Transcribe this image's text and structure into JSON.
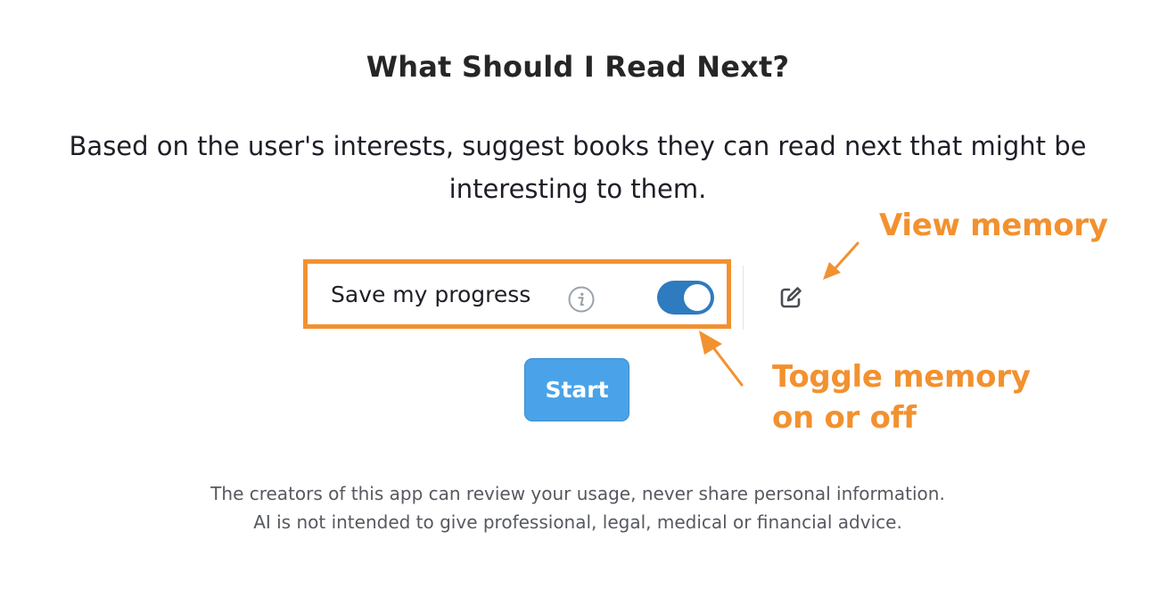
{
  "header": {
    "title": "What Should I Read Next?",
    "description": "Based on the user's interests, suggest books they can read next that might be interesting to them."
  },
  "memory": {
    "save_label": "Save my progress",
    "toggle_on": true,
    "info_icon": "info-icon",
    "edit_icon": "edit-icon"
  },
  "actions": {
    "start_label": "Start"
  },
  "annotations": {
    "view_memory": "View memory",
    "toggle_memory_line1": "Toggle memory",
    "toggle_memory_line2": "on or off",
    "color": "#f2912f"
  },
  "footer": {
    "line1": "The creators of this app can review your usage, never share personal information.",
    "line2": "AI is not intended to give professional, legal, medical or financial advice."
  },
  "colors": {
    "accent": "#f2912f",
    "toggle_on": "#2e7bbf",
    "button": "#4aa3e8"
  }
}
